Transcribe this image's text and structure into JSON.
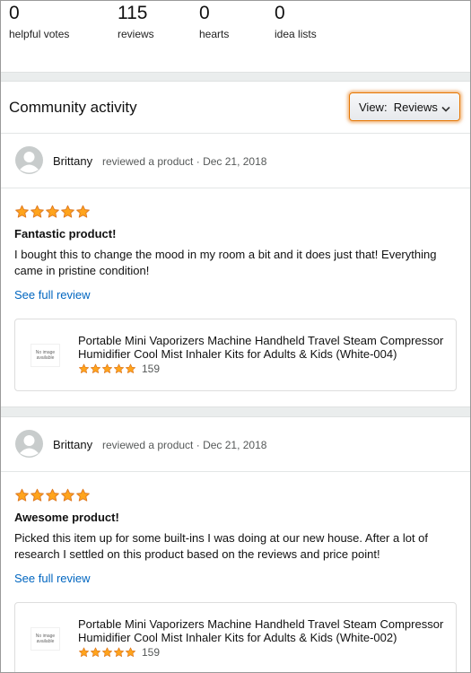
{
  "stats": [
    {
      "value": "0",
      "label": "helpful votes"
    },
    {
      "value": "115",
      "label": "reviews"
    },
    {
      "value": "0",
      "label": "hearts"
    },
    {
      "value": "0",
      "label": "idea lists"
    }
  ],
  "community": {
    "title": "Community activity",
    "view_label": "View:",
    "view_value": "Reviews"
  },
  "colors": {
    "star": "#ffa41c",
    "link": "#0066c0",
    "view_border": "#e77600"
  },
  "reviews": [
    {
      "author": "Brittany",
      "action": "reviewed a product",
      "date": "Dec 21, 2018",
      "rating": 5,
      "title": "Fantastic product!",
      "body": "I bought this to change the mood in my room a bit and it does just that! Everything came in pristine condition!",
      "see_full": "See full review",
      "product": {
        "no_image": "No image available",
        "title": "Portable Mini Vaporizers Machine Handheld Travel Steam Compressor Humidifier Cool Mist Inhaler Kits for Adults & Kids (White-004)",
        "rating": 5,
        "rating_count": "159"
      }
    },
    {
      "author": "Brittany",
      "action": "reviewed a product",
      "date": "Dec 21, 2018",
      "rating": 5,
      "title": "Awesome product!",
      "body": "Picked this item up for some built-ins I was doing at our new house. After a lot of research I settled on this product based on the reviews and price point!",
      "see_full": "See full review",
      "product": {
        "no_image": "No image available",
        "title": "Portable Mini Vaporizers Machine Handheld Travel Steam Compressor Humidifier Cool Mist Inhaler Kits for Adults & Kids (White-002)",
        "rating": 5,
        "rating_count": "159"
      }
    }
  ]
}
